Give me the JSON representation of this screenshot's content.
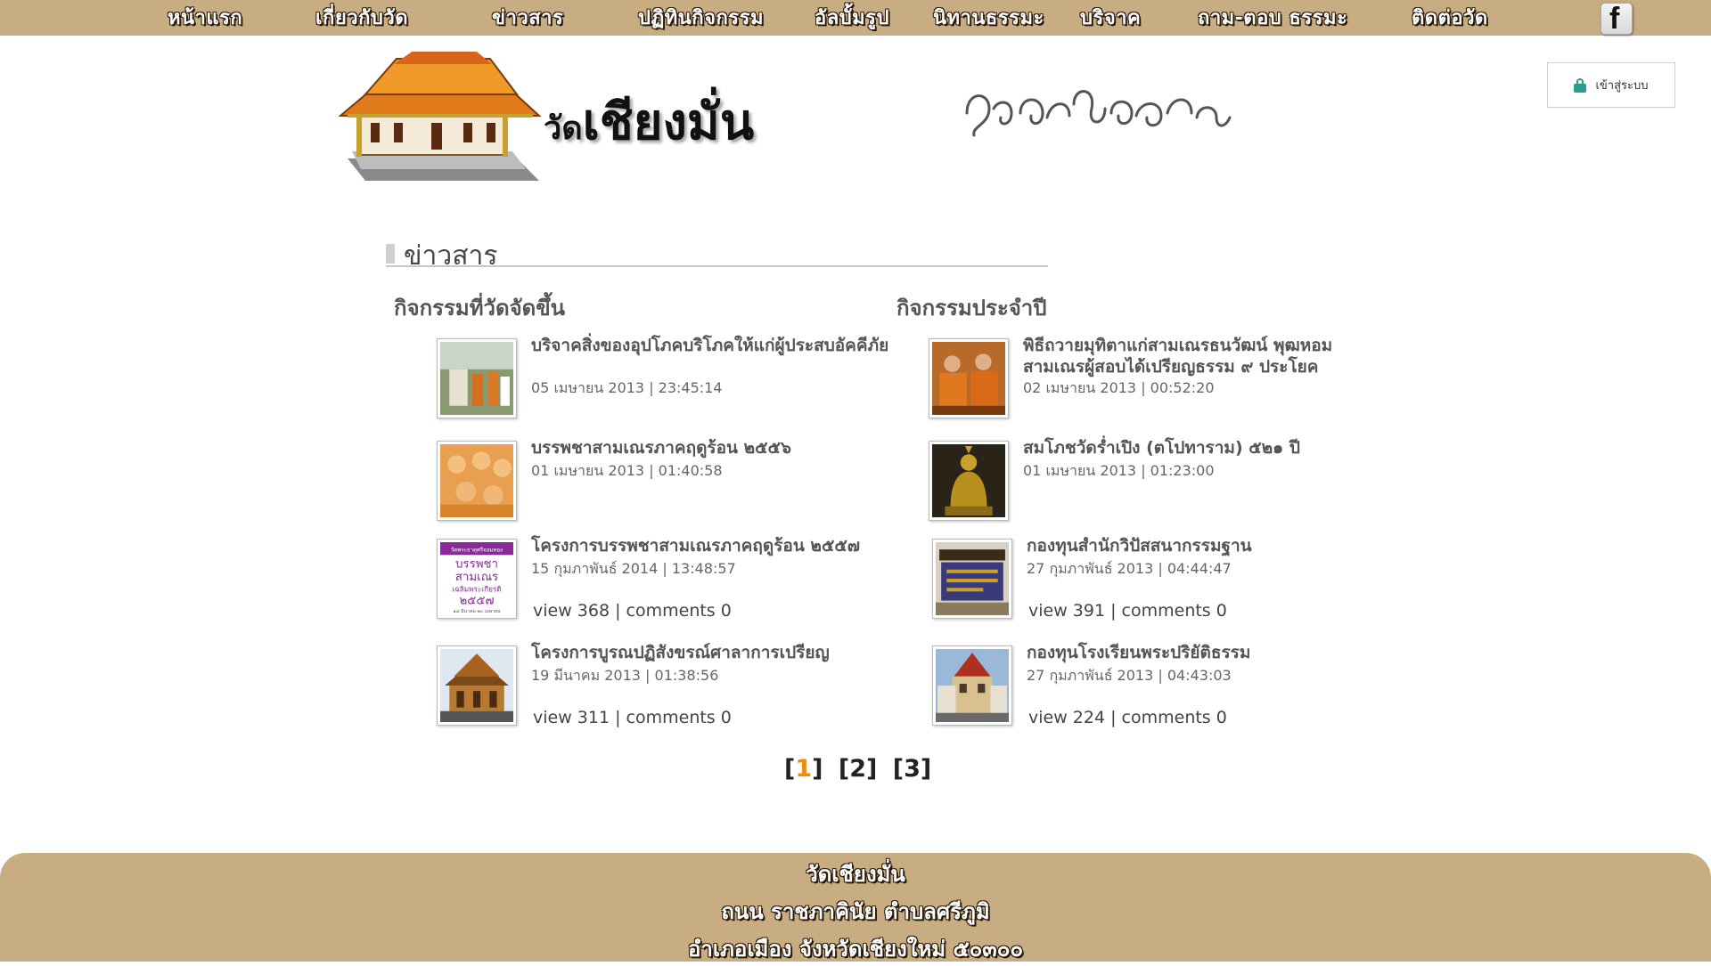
{
  "nav": {
    "items": [
      "หน้าแรก",
      "เกี่ยวกับวัด",
      "ข่าวสาร",
      "ปฏิทินกิจกรรม",
      "อัลบั้มรูป",
      "นิทานธรรมะ",
      "บริจาค",
      "ถาม-ตอบ ธรรมะ",
      "ติดต่อวัด"
    ],
    "facebook_icon": "facebook-icon"
  },
  "header": {
    "title_prefix": "วัด",
    "title_main": "เชียงมั่น",
    "lanna_script": "ᩅᩢ᩠ᨯᨩ᩠ᨿᨦᨾᩢ᩠ᨶ",
    "login_label": "เข้าสู่ระบบ",
    "login_icon": "lock-icon",
    "accent": "#2a9d8f"
  },
  "section": {
    "title": "ข่าวสาร"
  },
  "columns": {
    "left_title": "กิจกรรมที่วัดจัดขึ้น",
    "right_title": "กิจกรรมประจำปี"
  },
  "left_items": [
    {
      "title": "บริจาคสิ่งของอุปโภคบริโภคให้แก่ผู้ประสบอัคคีภัย",
      "date": "05 เมษายน 2013 | 23:45:14",
      "meta": ""
    },
    {
      "title": "บรรพชาสามเณรภาคฤดูร้อน ๒๕๕๖",
      "date": "01 เมษายน 2013 | 01:40:58",
      "meta": ""
    },
    {
      "title": "โครงการบรรพชาสามเณรภาคฤดูร้อน ๒๕๕๗",
      "date": "15 กุมภาพันธ์ 2014 | 13:48:57",
      "meta": "view 368 | comments 0"
    },
    {
      "title": "โครงการบูรณปฏิสังขรณ์ศาลาการเปรียญ",
      "date": "19 มีนาคม 2013 | 01:38:56",
      "meta": "view 311 | comments 0"
    }
  ],
  "right_items": [
    {
      "title": "พิธีถวายมุทิตาแก่สามเณรธนวัฒน์ พุฒหอม สามเณรผู้สอบได้เปรียญธรรม ๙ ประโยค",
      "date": "02 เมษายน 2013 | 00:52:20",
      "meta": ""
    },
    {
      "title": "สมโภชวัดร่ำเปิง (ตโปทาราม) ๕๒๑ ปี",
      "date": "01 เมษายน 2013 | 01:23:00",
      "meta": ""
    },
    {
      "title": "กองทุนสำนักวิปัสสนากรรมฐาน",
      "date": "27 กุมภาพันธ์ 2013 | 04:44:47",
      "meta": "view 391 | comments 0"
    },
    {
      "title": "กองทุนโรงเรียนพระปริยัติธรรม",
      "date": "27 กุมภาพันธ์ 2013 | 04:43:03",
      "meta": "view 224 | comments 0"
    }
  ],
  "poster_text": {
    "top": "วัดพระธาตุศรีจอมทอง",
    "l1": "บรรพชา",
    "l2": "สามเณร",
    "l3": "เฉลิมพระเกียรติ",
    "l4": "๒๕๕๗",
    "bottom": "๑๘ มีนาคม-๒๐ เมษายน"
  },
  "pager": {
    "pages": [
      "1",
      "2",
      "3"
    ],
    "current": "1"
  },
  "footer": {
    "line1": "วัดเชียงมั่น",
    "line2": "ถนน ราชภาคินัย ตำบลศรีภูมิ",
    "line3": "อำเภอเมือง จังหวัดเชียงใหม่ ๕๐๓๐๐"
  },
  "colors": {
    "bar": "#c8ad82",
    "pager_current": "#f08a0a"
  }
}
